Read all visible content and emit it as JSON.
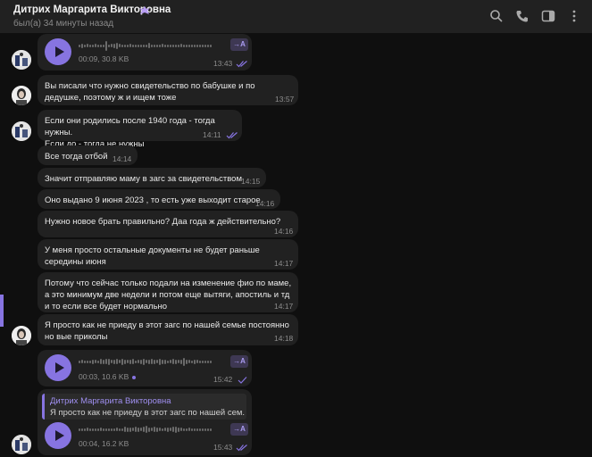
{
  "chat": {
    "contact_name": "Дитрих Маргарита Викторовна",
    "status": "был(а) 34 минуты назад"
  },
  "header_icons": [
    "search-icon",
    "phone-icon",
    "sidebar-toggle-icon",
    "more-vert-icon"
  ],
  "colors": {
    "accent": "#8774e1",
    "bubble": "#212121",
    "background": "#0f0f0f"
  },
  "messages": [
    {
      "type": "voice",
      "meta": "00:09, 30.8 KB",
      "time": "13:43",
      "transcribe": "→A",
      "read": true
    },
    {
      "type": "text",
      "text": "Вы писали что нужно свидетельство по бабушке и по дедушке, поэтому ж и ищем тоже",
      "time": "13:57"
    },
    {
      "type": "text",
      "text": "Если они родились после 1940 года - тогда нужны.\nЕсли до - тогда не нужны",
      "time": "14:11",
      "read": true
    },
    {
      "type": "text",
      "text": "Все тогда отбой",
      "time": "14:14"
    },
    {
      "type": "text",
      "text": "Значит отправляю маму в загс за свидетельством",
      "time": "14:15"
    },
    {
      "type": "text",
      "text": "Оно выдано 9 июня 2023 , то есть уже выходит старое",
      "time": "14:16"
    },
    {
      "type": "text",
      "text": "Нужно новое брать правильно? Даа года ж действительно?",
      "time": "14:16"
    },
    {
      "type": "text",
      "text": "У меня просто остальные документы не будет раньше середины июня",
      "time": "14:17"
    },
    {
      "type": "text",
      "text": "Потому что сейчас только подали на изменение фио по маме, а это минимум две недели и потом еще вытяги, апостиль и тд и то если все будет нормально",
      "time": "14:17"
    },
    {
      "type": "text",
      "text": "Я просто как не приеду в этот загс по нашей семье постоянно но вые приколы",
      "time": "14:18"
    },
    {
      "type": "voice",
      "meta": "00:03, 10.6 KB",
      "time": "15:42",
      "transcribe": "→A",
      "read": false
    },
    {
      "type": "voice_reply",
      "reply_name": "Дитрих Маргарита Викторовна",
      "reply_text": "Я просто как не приеду в этот загс по нашей сем...",
      "meta": "00:04, 16.2 KB",
      "time": "15:43",
      "transcribe": "→A",
      "read": true
    }
  ]
}
